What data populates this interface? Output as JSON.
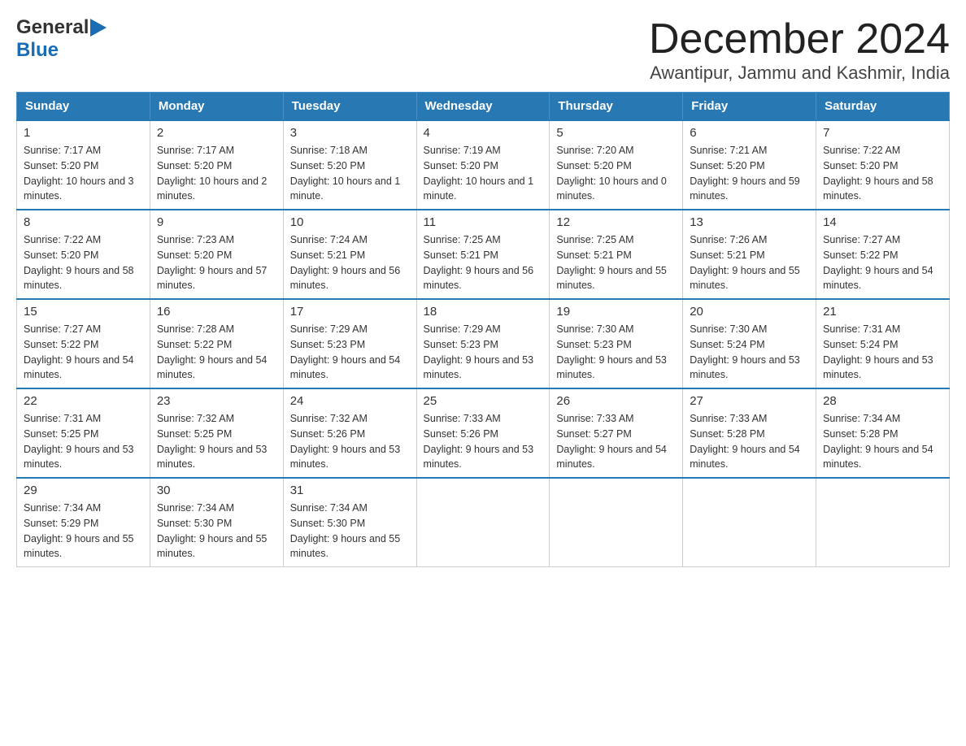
{
  "header": {
    "logo_general": "General",
    "logo_blue": "Blue",
    "title": "December 2024",
    "subtitle": "Awantipur, Jammu and Kashmir, India"
  },
  "days_of_week": [
    "Sunday",
    "Monday",
    "Tuesday",
    "Wednesday",
    "Thursday",
    "Friday",
    "Saturday"
  ],
  "weeks": [
    [
      {
        "day": "1",
        "sunrise": "7:17 AM",
        "sunset": "5:20 PM",
        "daylight": "10 hours and 3 minutes."
      },
      {
        "day": "2",
        "sunrise": "7:17 AM",
        "sunset": "5:20 PM",
        "daylight": "10 hours and 2 minutes."
      },
      {
        "day": "3",
        "sunrise": "7:18 AM",
        "sunset": "5:20 PM",
        "daylight": "10 hours and 1 minute."
      },
      {
        "day": "4",
        "sunrise": "7:19 AM",
        "sunset": "5:20 PM",
        "daylight": "10 hours and 1 minute."
      },
      {
        "day": "5",
        "sunrise": "7:20 AM",
        "sunset": "5:20 PM",
        "daylight": "10 hours and 0 minutes."
      },
      {
        "day": "6",
        "sunrise": "7:21 AM",
        "sunset": "5:20 PM",
        "daylight": "9 hours and 59 minutes."
      },
      {
        "day": "7",
        "sunrise": "7:22 AM",
        "sunset": "5:20 PM",
        "daylight": "9 hours and 58 minutes."
      }
    ],
    [
      {
        "day": "8",
        "sunrise": "7:22 AM",
        "sunset": "5:20 PM",
        "daylight": "9 hours and 58 minutes."
      },
      {
        "day": "9",
        "sunrise": "7:23 AM",
        "sunset": "5:20 PM",
        "daylight": "9 hours and 57 minutes."
      },
      {
        "day": "10",
        "sunrise": "7:24 AM",
        "sunset": "5:21 PM",
        "daylight": "9 hours and 56 minutes."
      },
      {
        "day": "11",
        "sunrise": "7:25 AM",
        "sunset": "5:21 PM",
        "daylight": "9 hours and 56 minutes."
      },
      {
        "day": "12",
        "sunrise": "7:25 AM",
        "sunset": "5:21 PM",
        "daylight": "9 hours and 55 minutes."
      },
      {
        "day": "13",
        "sunrise": "7:26 AM",
        "sunset": "5:21 PM",
        "daylight": "9 hours and 55 minutes."
      },
      {
        "day": "14",
        "sunrise": "7:27 AM",
        "sunset": "5:22 PM",
        "daylight": "9 hours and 54 minutes."
      }
    ],
    [
      {
        "day": "15",
        "sunrise": "7:27 AM",
        "sunset": "5:22 PM",
        "daylight": "9 hours and 54 minutes."
      },
      {
        "day": "16",
        "sunrise": "7:28 AM",
        "sunset": "5:22 PM",
        "daylight": "9 hours and 54 minutes."
      },
      {
        "day": "17",
        "sunrise": "7:29 AM",
        "sunset": "5:23 PM",
        "daylight": "9 hours and 54 minutes."
      },
      {
        "day": "18",
        "sunrise": "7:29 AM",
        "sunset": "5:23 PM",
        "daylight": "9 hours and 53 minutes."
      },
      {
        "day": "19",
        "sunrise": "7:30 AM",
        "sunset": "5:23 PM",
        "daylight": "9 hours and 53 minutes."
      },
      {
        "day": "20",
        "sunrise": "7:30 AM",
        "sunset": "5:24 PM",
        "daylight": "9 hours and 53 minutes."
      },
      {
        "day": "21",
        "sunrise": "7:31 AM",
        "sunset": "5:24 PM",
        "daylight": "9 hours and 53 minutes."
      }
    ],
    [
      {
        "day": "22",
        "sunrise": "7:31 AM",
        "sunset": "5:25 PM",
        "daylight": "9 hours and 53 minutes."
      },
      {
        "day": "23",
        "sunrise": "7:32 AM",
        "sunset": "5:25 PM",
        "daylight": "9 hours and 53 minutes."
      },
      {
        "day": "24",
        "sunrise": "7:32 AM",
        "sunset": "5:26 PM",
        "daylight": "9 hours and 53 minutes."
      },
      {
        "day": "25",
        "sunrise": "7:33 AM",
        "sunset": "5:26 PM",
        "daylight": "9 hours and 53 minutes."
      },
      {
        "day": "26",
        "sunrise": "7:33 AM",
        "sunset": "5:27 PM",
        "daylight": "9 hours and 54 minutes."
      },
      {
        "day": "27",
        "sunrise": "7:33 AM",
        "sunset": "5:28 PM",
        "daylight": "9 hours and 54 minutes."
      },
      {
        "day": "28",
        "sunrise": "7:34 AM",
        "sunset": "5:28 PM",
        "daylight": "9 hours and 54 minutes."
      }
    ],
    [
      {
        "day": "29",
        "sunrise": "7:34 AM",
        "sunset": "5:29 PM",
        "daylight": "9 hours and 55 minutes."
      },
      {
        "day": "30",
        "sunrise": "7:34 AM",
        "sunset": "5:30 PM",
        "daylight": "9 hours and 55 minutes."
      },
      {
        "day": "31",
        "sunrise": "7:34 AM",
        "sunset": "5:30 PM",
        "daylight": "9 hours and 55 minutes."
      },
      null,
      null,
      null,
      null
    ]
  ],
  "labels": {
    "sunrise": "Sunrise:",
    "sunset": "Sunset:",
    "daylight": "Daylight:"
  }
}
